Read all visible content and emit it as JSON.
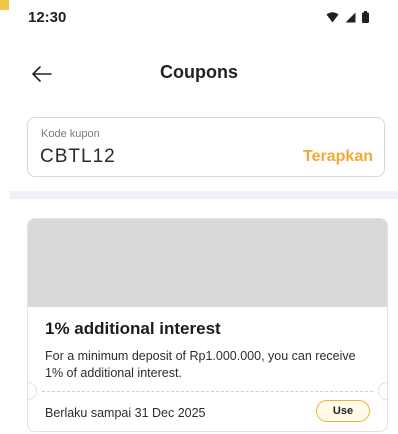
{
  "status_bar": {
    "time": "12:30",
    "icons": [
      "wifi-icon",
      "cellular-signal-icon",
      "battery-icon"
    ]
  },
  "header": {
    "back_icon": "arrow-left-icon",
    "title": "Coupons"
  },
  "coupon_input": {
    "label": "Kode kupon",
    "value": "CBTL12",
    "apply_label": "Terapkan"
  },
  "coupons": [
    {
      "title": "1% additional interest",
      "description": "For a minimum deposit of Rp1.000.000, you can receive 1% of additional interest.",
      "validity": "Berlaku sampai 31 Dec 2025",
      "use_label": "Use"
    }
  ],
  "colors": {
    "accent": "#f2a933",
    "use_border": "#e9b23a",
    "banner_placeholder": "#d9d9d9",
    "divider": "#eef1f5"
  }
}
